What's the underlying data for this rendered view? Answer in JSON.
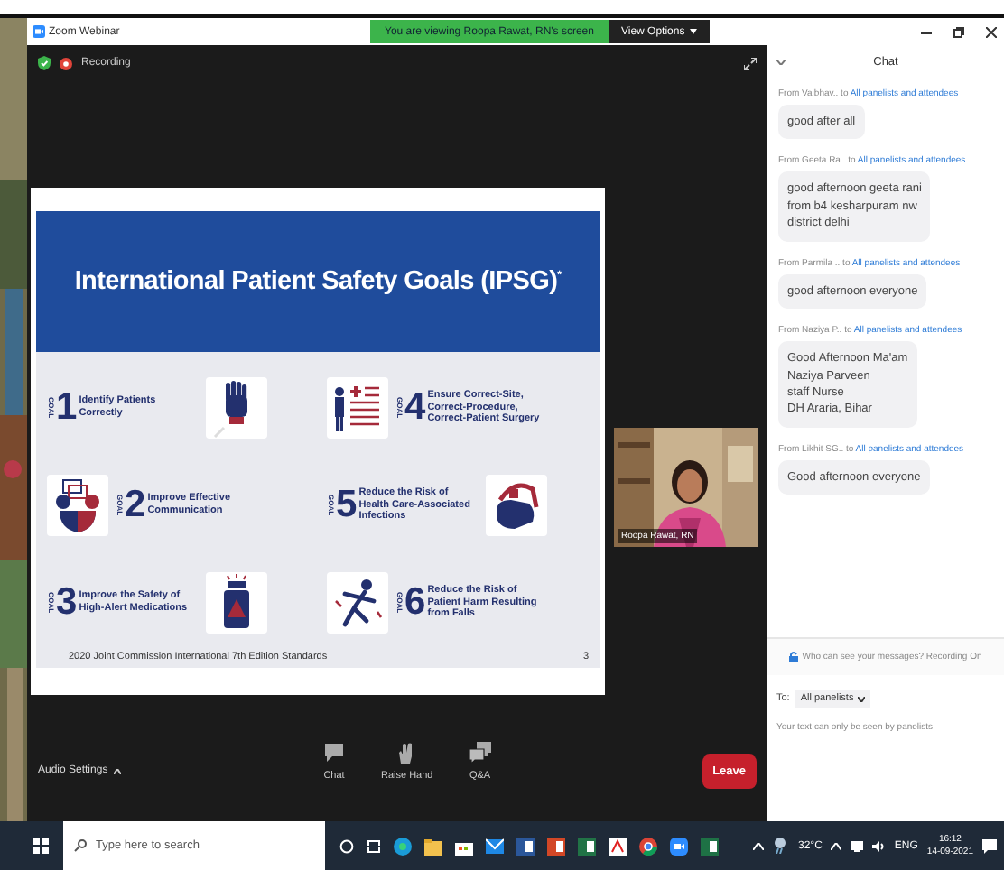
{
  "window": {
    "app_title": "Zoom Webinar",
    "banner": "You are viewing Roopa Rawat, RN's screen",
    "view_options": "View Options"
  },
  "meeting": {
    "recording_label": "Recording",
    "slide": {
      "title": "International Patient Safety Goals (IPSG)$^{*}$",
      "goals": [
        {
          "goal_label": "GOAL",
          "number": "1",
          "text": "Identify Patients Correctly"
        },
        {
          "goal_label": "GOAL",
          "number": "2",
          "text": "Improve Effective Communication"
        },
        {
          "goal_label": "GOAL",
          "number": "3",
          "text": "Improve the Safety of High-Alert Medications"
        },
        {
          "goal_label": "GOAL",
          "number": "4",
          "text": "Ensure Correct-Site, Correct-Procedure, Correct-Patient Surgery"
        },
        {
          "goal_label": "GOAL",
          "number": "5",
          "text": "Reduce the Risk of Health Care-Associated Infections"
        },
        {
          "goal_label": "GOAL",
          "number": "6",
          "text": "Reduce the Risk of Patient Harm Resulting from Falls"
        }
      ],
      "footer": "2020 Joint Commission International 7th Edition Standards",
      "page": "3"
    },
    "video": {
      "name": "Roopa Rawat, RN"
    },
    "toolbar": {
      "audio_settings": "Audio Settings",
      "buttons": [
        {
          "label": "Chat"
        },
        {
          "label": "Raise Hand"
        },
        {
          "label": "Q&A"
        }
      ],
      "leave": "Leave"
    }
  },
  "chat": {
    "title": "Chat",
    "messages": [
      {
        "from": "From Vaibhav.. to",
        "to": "All panelists and attendees",
        "text": "good after all"
      },
      {
        "from": "From Geeta Ra.. to",
        "to": "All panelists and attendees",
        "text": "good afternoon geeta rani\nfrom b4 kesharpuram  nw\ndistrict  delhi"
      },
      {
        "from": "From Parmila .. to",
        "to": "All panelists and attendees",
        "text": "good afternoon everyone"
      },
      {
        "from": "From Naziya P.. to",
        "to": "All panelists and attendees",
        "text": "Good Afternoon Ma'am\nNaziya Parveen\nstaff Nurse\nDH Araria, Bihar"
      },
      {
        "from": "From Likhit SG.. to",
        "to": "All panelists and attendees",
        "text": "Good afternoon everyone"
      }
    ],
    "notice": "Who can see your messages? Recording On",
    "to_label": "To:",
    "recipient": "All panelists",
    "hint": "Your text can only be seen by panelists"
  },
  "taskbar": {
    "search_placeholder": "Type here to search",
    "temperature": "32°C",
    "language": "ENG",
    "time": "16:12",
    "date": "14-09-2021"
  }
}
